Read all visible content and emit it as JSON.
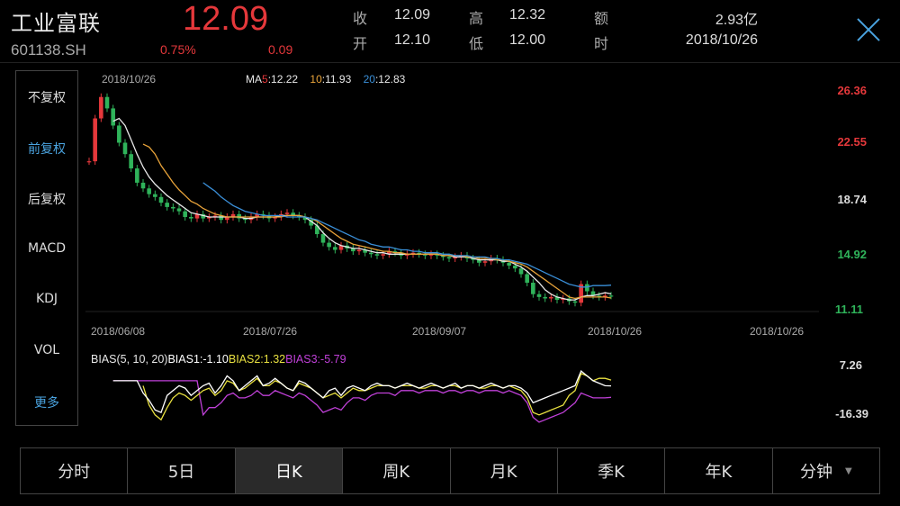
{
  "stock": {
    "name": "工业富联",
    "code": "601138.SH",
    "price": "12.09",
    "change_pct": "0.75%",
    "change": "0.09"
  },
  "quote": [
    {
      "label": "收",
      "value": "12.09"
    },
    {
      "label": "高",
      "value": "12.32"
    },
    {
      "label": "额",
      "value": "2.93亿"
    },
    {
      "label": "开",
      "value": "12.10"
    },
    {
      "label": "低",
      "value": "12.00"
    },
    {
      "label": "时",
      "value": "2018/10/26"
    }
  ],
  "side_menu": [
    {
      "label": "不复权",
      "active": false
    },
    {
      "label": "前复权",
      "active": true
    },
    {
      "label": "后复权",
      "active": false
    },
    {
      "label": "MACD",
      "active": false
    },
    {
      "label": "KDJ",
      "active": false
    },
    {
      "label": "VOL",
      "active": false
    },
    {
      "label": "更多",
      "active": true
    }
  ],
  "colors": {
    "up": "#e5383b",
    "down": "#2fb35a",
    "accent": "#4aa3df",
    "ma5": "#e8e8e8",
    "ma10": "#e8a33a",
    "ma20": "#3a8fd8",
    "bias1": "#ffffff",
    "bias2": "#e8e040",
    "bias3": "#c040d8"
  },
  "chart_header": {
    "date": "2018/10/26",
    "ma_prefix": "MA",
    "ma5_key": "5",
    "ma5_val": ":12.22",
    "ma10_key": "10",
    "ma10_val": ":11.93",
    "ma20_key": "20",
    "ma20_val": ":12.83"
  },
  "bias_header": {
    "title": "BIAS(5, 10, 20)",
    "b1": "BIAS1:-1.10",
    "b2": "BIAS2:1.32",
    "b3": "BIAS3:-5.79"
  },
  "chart_data": {
    "type": "candlestick",
    "y_ticks": [
      "26.36",
      "22.55",
      "18.74",
      "14.92",
      "11.11"
    ],
    "ylim": [
      11.11,
      26.36
    ],
    "x_ticks": [
      "2018/06/08",
      "2018/07/26",
      "2018/09/07",
      "2018/10/26",
      "2018/10/26"
    ],
    "bias_ticks": [
      "7.26",
      "-16.39"
    ],
    "bias_ylim": [
      -16.39,
      7.26
    ],
    "price_path": [
      21.5,
      24.5,
      26.0,
      25.2,
      24.0,
      22.8,
      22.0,
      21.0,
      20.0,
      19.6,
      19.2,
      19.0,
      18.6,
      18.3,
      18.2,
      18.0,
      17.6,
      17.5,
      17.8,
      17.5,
      17.6,
      17.7,
      17.4,
      17.6,
      17.8,
      17.5,
      17.4,
      17.6,
      17.8,
      17.7,
      17.5,
      17.6,
      17.8,
      17.9,
      17.7,
      17.6,
      17.4,
      17.0,
      16.4,
      15.8,
      15.5,
      15.3,
      15.6,
      15.4,
      15.2,
      15.3,
      15.1,
      15.0,
      14.9,
      15.0,
      15.2,
      15.1,
      14.9,
      15.0,
      15.1,
      15.0,
      14.9,
      15.0,
      14.9,
      14.8,
      14.7,
      14.8,
      14.9,
      14.7,
      14.6,
      14.4,
      14.5,
      14.7,
      14.6,
      14.4,
      14.2,
      14.0,
      13.6,
      13.0,
      12.2,
      12.0,
      11.9,
      12.0,
      11.8,
      11.9,
      11.7,
      11.6,
      12.9,
      12.4,
      12.1,
      12.0,
      12.1,
      12.09
    ],
    "ma5": [
      null,
      null,
      null,
      null,
      24.3,
      24.5,
      24.0,
      23.0,
      22.0,
      21.1,
      20.4,
      19.9,
      19.5,
      19.1,
      18.8,
      18.5,
      18.2,
      17.9,
      17.8,
      17.7,
      17.6,
      17.6,
      17.6,
      17.6,
      17.6,
      17.6,
      17.5,
      17.5,
      17.6,
      17.6,
      17.6,
      17.6,
      17.7,
      17.7,
      17.7,
      17.7,
      17.6,
      17.3,
      17.0,
      16.5,
      16.1,
      15.8,
      15.6,
      15.5,
      15.4,
      15.4,
      15.3,
      15.2,
      15.1,
      15.1,
      15.0,
      15.0,
      15.0,
      15.0,
      15.0,
      15.0,
      15.0,
      15.0,
      15.0,
      14.9,
      14.9,
      14.8,
      14.8,
      14.8,
      14.7,
      14.6,
      14.6,
      14.6,
      14.6,
      14.5,
      14.5,
      14.3,
      14.1,
      13.8,
      13.4,
      13.0,
      12.5,
      12.2,
      12.0,
      11.9,
      11.8,
      11.8,
      12.0,
      12.1,
      12.1,
      12.2,
      12.3,
      12.22
    ],
    "ma10": [
      null,
      null,
      null,
      null,
      null,
      null,
      null,
      null,
      null,
      22.7,
      22.5,
      22.0,
      21.2,
      20.6,
      20.0,
      19.5,
      19.1,
      18.7,
      18.5,
      18.2,
      18.0,
      17.8,
      17.7,
      17.6,
      17.6,
      17.6,
      17.6,
      17.6,
      17.6,
      17.6,
      17.6,
      17.6,
      17.6,
      17.7,
      17.7,
      17.7,
      17.6,
      17.5,
      17.3,
      17.0,
      16.7,
      16.4,
      16.1,
      15.9,
      15.7,
      15.6,
      15.5,
      15.4,
      15.3,
      15.2,
      15.2,
      15.1,
      15.1,
      15.0,
      15.0,
      15.0,
      15.0,
      15.0,
      15.0,
      14.9,
      14.9,
      14.9,
      14.9,
      14.8,
      14.8,
      14.7,
      14.7,
      14.7,
      14.6,
      14.6,
      14.5,
      14.4,
      14.3,
      14.1,
      13.8,
      13.5,
      13.2,
      12.9,
      12.6,
      12.3,
      12.0,
      11.9,
      12.0,
      12.0,
      12.0,
      12.0,
      12.0,
      11.93
    ],
    "ma20": [
      null,
      null,
      null,
      null,
      null,
      null,
      null,
      null,
      null,
      null,
      null,
      null,
      null,
      null,
      null,
      null,
      null,
      null,
      null,
      20.0,
      19.7,
      19.4,
      19.0,
      18.7,
      18.4,
      18.2,
      18.0,
      17.9,
      17.8,
      17.7,
      17.7,
      17.7,
      17.7,
      17.6,
      17.6,
      17.6,
      17.6,
      17.5,
      17.4,
      17.2,
      17.0,
      16.8,
      16.6,
      16.4,
      16.2,
      16.0,
      15.9,
      15.7,
      15.6,
      15.5,
      15.5,
      15.4,
      15.3,
      15.3,
      15.2,
      15.2,
      15.1,
      15.1,
      15.1,
      15.0,
      15.0,
      14.9,
      14.9,
      14.9,
      14.8,
      14.8,
      14.8,
      14.7,
      14.7,
      14.6,
      14.6,
      14.5,
      14.4,
      14.3,
      14.1,
      13.9,
      13.7,
      13.5,
      13.3,
      13.1,
      12.9,
      12.8,
      12.7,
      12.7,
      12.8,
      12.8,
      12.8,
      12.83
    ],
    "bias1": [
      null,
      null,
      null,
      null,
      1,
      1,
      1,
      1,
      1,
      -4,
      -7,
      -11,
      -12,
      -5,
      -3,
      -1,
      -2,
      -5,
      -3,
      -1,
      0,
      -4,
      -1,
      3,
      1,
      -3,
      -1,
      1,
      3,
      -1,
      0,
      2,
      0,
      -2,
      -3,
      1,
      0,
      -2,
      -4,
      -6,
      -3,
      -2,
      -5,
      -2,
      -1,
      -2,
      -3,
      -1,
      0,
      -1,
      -1,
      -2,
      -1,
      0,
      -1,
      -2,
      -1,
      0,
      -1,
      -2,
      -1,
      0,
      -2,
      -1,
      -1,
      -2,
      -1,
      0,
      -1,
      -2,
      -1,
      -1,
      -2,
      -4,
      -8,
      -7,
      -6,
      -5,
      -4,
      -3,
      -2,
      -1,
      5,
      3,
      1,
      0,
      -1,
      -1.1
    ],
    "bias2": [
      null,
      null,
      null,
      null,
      null,
      null,
      null,
      null,
      null,
      -1,
      -9,
      -13,
      -15,
      -10,
      -6,
      -4,
      -5,
      -7,
      -5,
      -3,
      -2,
      -5,
      -3,
      1,
      0,
      -3,
      -2,
      0,
      2,
      -1,
      -1,
      1,
      0,
      -2,
      -3,
      0,
      -1,
      -2,
      -4,
      -6,
      -5,
      -4,
      -6,
      -4,
      -2,
      -3,
      -3,
      -2,
      -1,
      -1,
      -1,
      -2,
      -1,
      -1,
      -1,
      -2,
      -2,
      -1,
      -1,
      -2,
      -1,
      -1,
      -2,
      -1,
      -1,
      -2,
      -2,
      -1,
      -1,
      -2,
      -1,
      -2,
      -3,
      -6,
      -12,
      -13,
      -12,
      -11,
      -10,
      -9,
      -5,
      -3,
      4,
      3,
      1,
      2,
      2,
      1.32
    ],
    "bias3": [
      null,
      null,
      null,
      null,
      1,
      1,
      1,
      1,
      1,
      1,
      1,
      1,
      1,
      1,
      1,
      1,
      1,
      1,
      1,
      -13,
      -10,
      -10,
      -8,
      -5,
      -4,
      -6,
      -6,
      -5,
      -3,
      -5,
      -5,
      -3,
      -4,
      -5,
      -6,
      -4,
      -5,
      -7,
      -9,
      -12,
      -11,
      -10,
      -11,
      -8,
      -6,
      -6,
      -7,
      -5,
      -4,
      -4,
      -4,
      -5,
      -3,
      -3,
      -3,
      -4,
      -3,
      -3,
      -3,
      -4,
      -3,
      -3,
      -4,
      -3,
      -3,
      -4,
      -3,
      -3,
      -3,
      -4,
      -3,
      -4,
      -5,
      -8,
      -14,
      -16,
      -15,
      -14,
      -13,
      -12,
      -10,
      -8,
      -4,
      -5,
      -6,
      -6,
      -6,
      -5.79
    ]
  },
  "tabs": [
    {
      "label": "分时",
      "active": false
    },
    {
      "label": "5日",
      "active": false
    },
    {
      "label": "日K",
      "active": true
    },
    {
      "label": "周K",
      "active": false
    },
    {
      "label": "月K",
      "active": false
    },
    {
      "label": "季K",
      "active": false
    },
    {
      "label": "年K",
      "active": false
    },
    {
      "label": "分钟",
      "active": false,
      "dropdown": true
    }
  ]
}
